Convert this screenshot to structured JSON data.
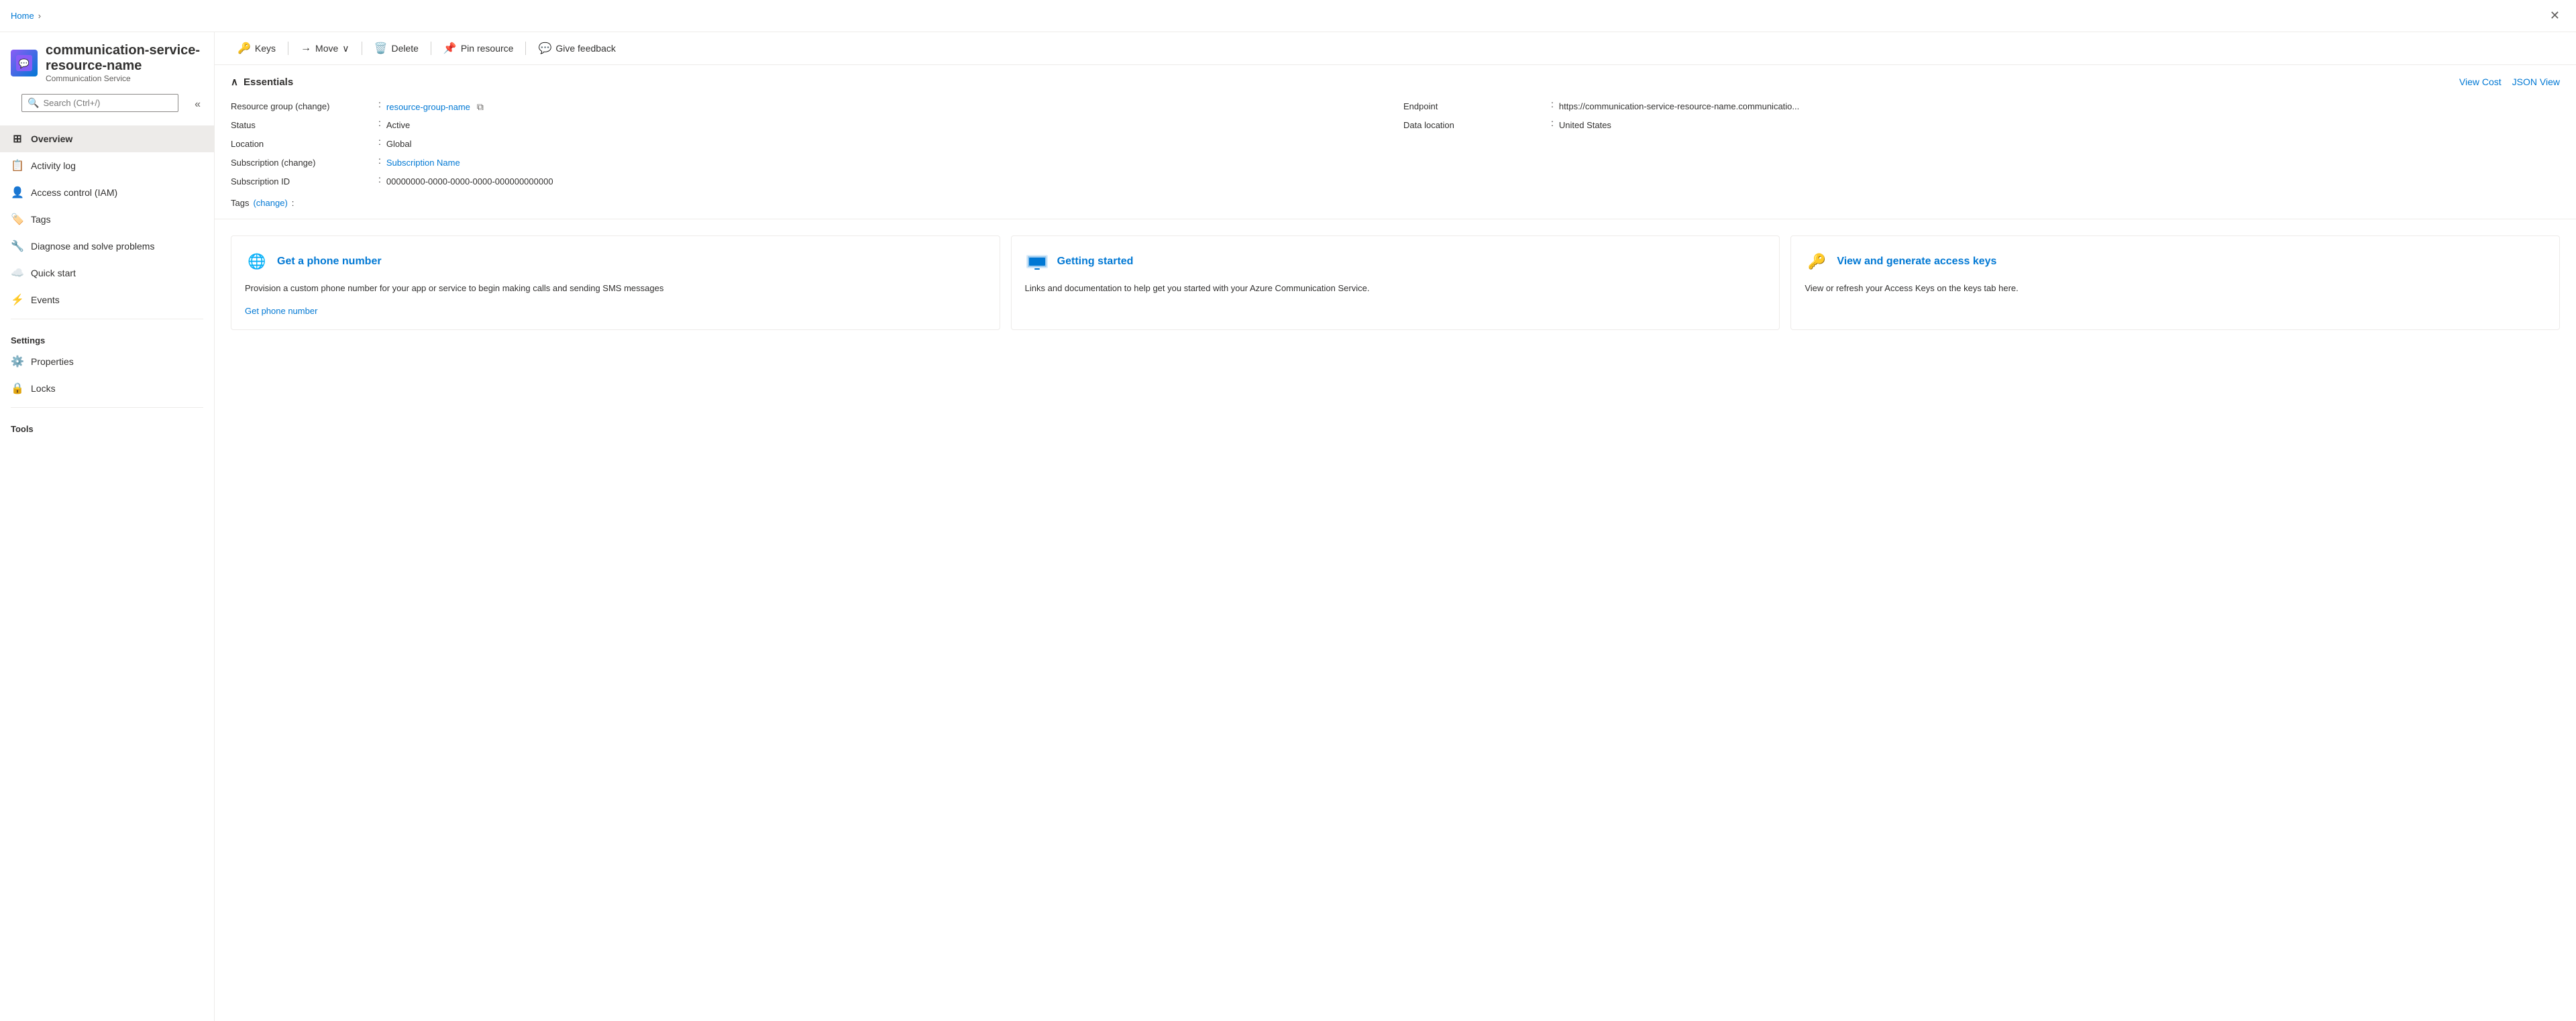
{
  "breadcrumb": {
    "home": "Home",
    "separator": "›"
  },
  "close_button": "✕",
  "resource": {
    "icon": "💬",
    "name": "communication-service-resource-name",
    "subtitle": "Communication Service"
  },
  "search": {
    "placeholder": "Search (Ctrl+/)"
  },
  "sidebar": {
    "nav_items": [
      {
        "id": "overview",
        "label": "Overview",
        "icon": "⊞",
        "active": true
      },
      {
        "id": "activity-log",
        "label": "Activity log",
        "icon": "📋",
        "active": false
      },
      {
        "id": "access-control",
        "label": "Access control (IAM)",
        "icon": "👤",
        "active": false
      },
      {
        "id": "tags",
        "label": "Tags",
        "icon": "🏷️",
        "active": false
      },
      {
        "id": "diagnose",
        "label": "Diagnose and solve problems",
        "icon": "🔧",
        "active": false
      }
    ],
    "quick_start": {
      "label": "Quick start",
      "icon": "☁️"
    },
    "events": {
      "label": "Events",
      "icon": "⚡"
    },
    "settings_section": "Settings",
    "settings_items": [
      {
        "id": "properties",
        "label": "Properties",
        "icon": "⚙️"
      },
      {
        "id": "locks",
        "label": "Locks",
        "icon": "🔒"
      }
    ],
    "tools_section": "Tools"
  },
  "toolbar": {
    "keys_label": "Keys",
    "move_label": "Move",
    "delete_label": "Delete",
    "pin_label": "Pin resource",
    "feedback_label": "Give feedback"
  },
  "essentials": {
    "section_title": "Essentials",
    "collapse_icon": "∧",
    "view_cost": "View Cost",
    "json_view": "JSON View",
    "fields": {
      "resource_group_label": "Resource group (change)",
      "resource_group_value": "resource-group-name",
      "endpoint_label": "Endpoint",
      "endpoint_value": "https://communication-service-resource-name.communicatio...",
      "status_label": "Status",
      "status_value": "Active",
      "data_location_label": "Data location",
      "data_location_value": "United States",
      "location_label": "Location",
      "location_value": "Global",
      "subscription_label": "Subscription (change)",
      "subscription_value": "Subscription Name",
      "subscription_id_label": "Subscription ID",
      "subscription_id_value": "00000000-0000-0000-0000-000000000000",
      "tags_label": "Tags (change)",
      "tags_value": ""
    }
  },
  "cards": [
    {
      "id": "phone-number",
      "icon": "🌐",
      "icon_type": "blue",
      "title": "Get a phone number",
      "description": "Provision a custom phone number for your app or service to begin making calls and sending SMS messages",
      "link_label": "Get phone number"
    },
    {
      "id": "getting-started",
      "icon": "🖥️",
      "icon_type": "blue",
      "title": "Getting started",
      "description": "Links and documentation to help get you started with your Azure Communication Service.",
      "link_label": ""
    },
    {
      "id": "access-keys",
      "icon": "🔑",
      "icon_type": "yellow",
      "title": "View and generate access keys",
      "description": "View or refresh your Access Keys on the keys tab here.",
      "link_label": ""
    }
  ]
}
